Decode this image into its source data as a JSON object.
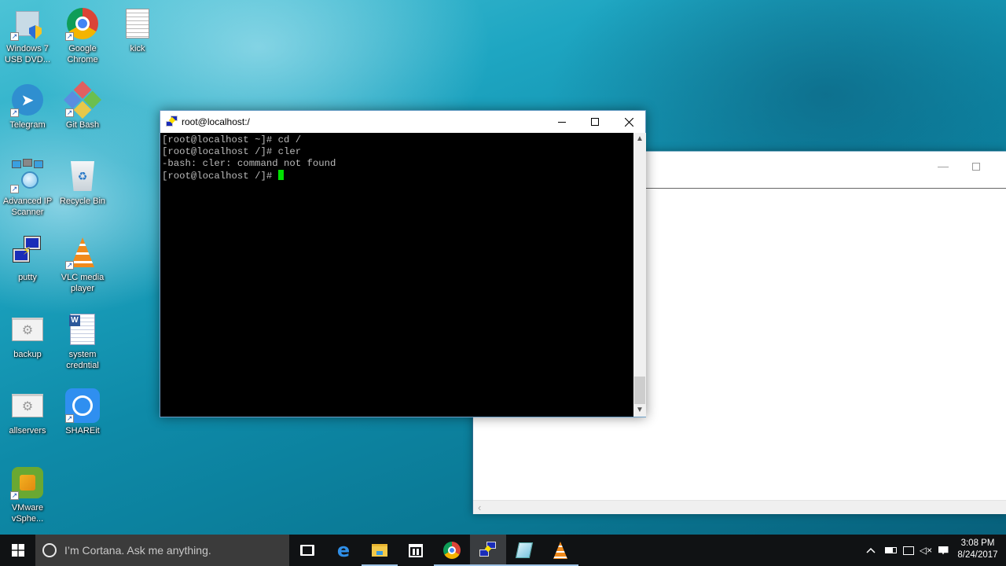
{
  "desktop": {
    "icons": [
      {
        "label": "Windows 7 USB DVD...",
        "icon": "windows-usb-dvd-tool-icon",
        "shortcut": true
      },
      {
        "label": "Google Chrome",
        "icon": "chrome-icon",
        "shortcut": true
      },
      {
        "label": "kick",
        "icon": "text-file-icon",
        "shortcut": false
      },
      {
        "label": "Telegram",
        "icon": "telegram-icon",
        "shortcut": true
      },
      {
        "label": "Git Bash",
        "icon": "git-bash-icon",
        "shortcut": true
      },
      {
        "label": "Advanced IP Scanner",
        "icon": "advanced-ip-scanner-icon",
        "shortcut": true
      },
      {
        "label": "Recycle Bin",
        "icon": "recycle-bin-icon",
        "shortcut": false
      },
      {
        "label": "putty",
        "icon": "putty-icon",
        "shortcut": false
      },
      {
        "label": "VLC media player",
        "icon": "vlc-icon",
        "shortcut": true
      },
      {
        "label": "backup",
        "icon": "batch-file-icon",
        "shortcut": false
      },
      {
        "label": "system credntial",
        "icon": "word-document-icon",
        "shortcut": false
      },
      {
        "label": "allservers",
        "icon": "batch-file-icon",
        "shortcut": false
      },
      {
        "label": "SHAREit",
        "icon": "shareit-icon",
        "shortcut": true
      },
      {
        "label": "VMware vSphe...",
        "icon": "vmware-vsphere-icon",
        "shortcut": true
      }
    ]
  },
  "putty_window": {
    "title": "root@localhost:/",
    "terminal_lines": [
      "[root@localhost ~]# cd /",
      "[root@localhost /]# cler",
      "-bash: cler: command not found",
      "[root@localhost /]# "
    ],
    "cursor_color": "#00e000",
    "scroll_position": 1.0
  },
  "background_window": {
    "title": ""
  },
  "taskbar": {
    "cortana_placeholder": "I’m Cortana. Ask me anything.",
    "apps": [
      {
        "name": "task-view",
        "open": false,
        "active": false
      },
      {
        "name": "edge",
        "open": false,
        "active": false
      },
      {
        "name": "file-explorer",
        "open": true,
        "active": false
      },
      {
        "name": "store",
        "open": false,
        "active": false
      },
      {
        "name": "chrome",
        "open": true,
        "active": false
      },
      {
        "name": "putty",
        "open": true,
        "active": true
      },
      {
        "name": "notepad",
        "open": true,
        "active": false
      },
      {
        "name": "vlc",
        "open": true,
        "active": false
      }
    ],
    "clock": {
      "time": "3:08 PM",
      "date": "8/24/2017"
    }
  }
}
